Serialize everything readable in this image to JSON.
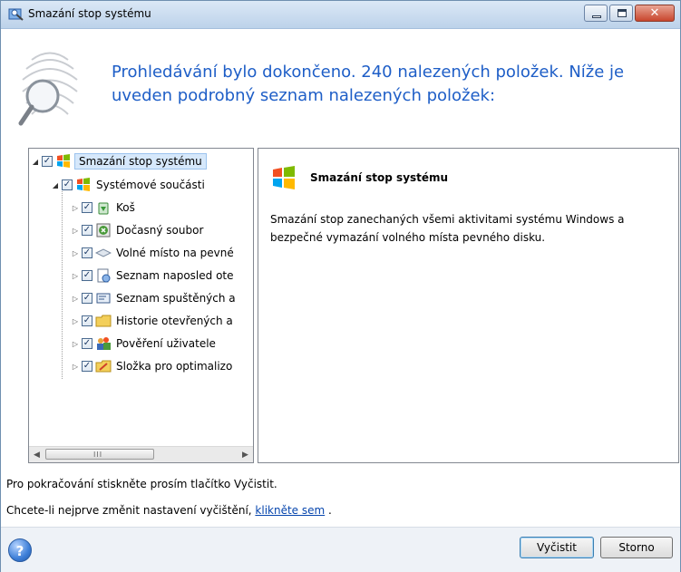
{
  "window": {
    "title": "Smazání stop systému",
    "controls": {
      "minimize": "minimize",
      "maximize": "maximize",
      "close": "✕"
    }
  },
  "header": {
    "heading": "Prohledávání bylo dokončeno. 240 nalezených položek. Níže je uveden podrobný seznam nalezených položek:",
    "icon": "fingerprint-magnifier-icon"
  },
  "tree": {
    "root": {
      "label": "Smazání stop systému",
      "checked": true,
      "icon": "windows-logo-icon"
    },
    "group": {
      "label": "Systémové součásti",
      "checked": true,
      "icon": "windows-logo-icon"
    },
    "items": [
      {
        "label": "Koš",
        "checked": true,
        "icon": "recycle-bin-icon"
      },
      {
        "label": "Dočasný soubor",
        "checked": true,
        "icon": "temp-file-icon"
      },
      {
        "label": "Volné místo na pevné",
        "checked": true,
        "icon": "disk-icon"
      },
      {
        "label": "Seznam naposled ote",
        "checked": true,
        "icon": "recent-docs-icon"
      },
      {
        "label": "Seznam spuštěných a",
        "checked": true,
        "icon": "run-list-icon"
      },
      {
        "label": "Historie otevřených a",
        "checked": true,
        "icon": "folder-history-icon"
      },
      {
        "label": "Pověření uživatele",
        "checked": true,
        "icon": "user-credentials-icon"
      },
      {
        "label": "Složka pro optimalizo",
        "checked": true,
        "icon": "prefetch-folder-icon"
      }
    ],
    "scroll_grip": "III"
  },
  "detail": {
    "title": "Smazání stop systému",
    "description": "Smazání stop zanechaných všemi aktivitami systému Windows a bezpečné vymazání volného místa pevného disku."
  },
  "messages": {
    "line1": "Pro pokračování stiskněte prosím tlačítko Vyčistit.",
    "line2_prefix": "Chcete-li nejprve změnit nastavení vyčištění, ",
    "line2_link": "klikněte sem",
    "line2_suffix": " ."
  },
  "footer": {
    "help_symbol": "?",
    "clean_button": "Vyčistit",
    "cancel_button": "Storno"
  },
  "colors": {
    "heading": "#1e5ec7",
    "link": "#0645ad",
    "selection": "#d6e8fb"
  }
}
